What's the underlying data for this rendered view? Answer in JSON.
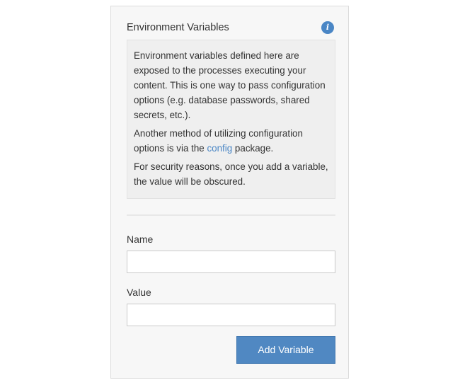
{
  "panel": {
    "title": "Environment Variables",
    "info_icon": "info-icon"
  },
  "help": {
    "paragraph1": "Environment variables defined here are exposed to the processes executing your content. This is one way to pass configuration options (e.g. database passwords, shared secrets, etc.).",
    "paragraph2_before": "Another method of utilizing configuration options is via the ",
    "paragraph2_link": "config",
    "paragraph2_after": " package.",
    "paragraph3": "For security reasons, once you add a variable, the value will be obscured."
  },
  "form": {
    "name_label": "Name",
    "name_value": "",
    "value_label": "Value",
    "value_value": "",
    "add_button_label": "Add Variable"
  },
  "colors": {
    "accent": "#4a86c5",
    "button": "#5088c2",
    "panel_bg": "#f7f7f7",
    "help_bg": "#efefef"
  }
}
